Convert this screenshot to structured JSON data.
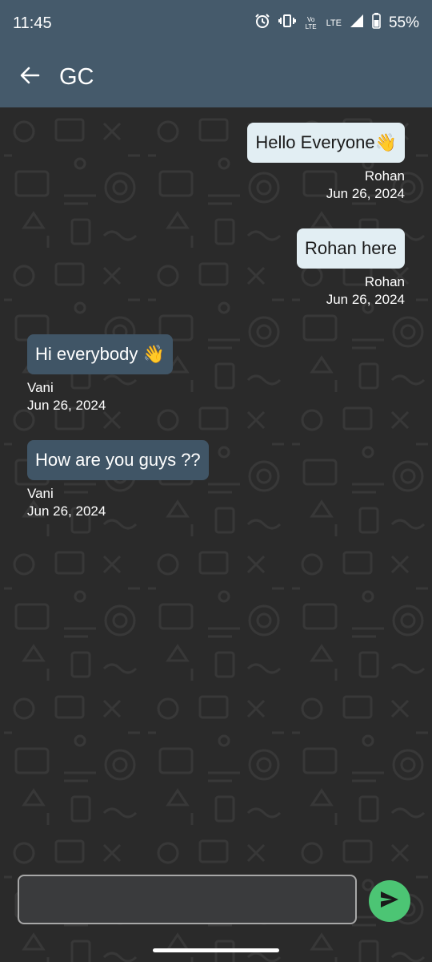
{
  "status_bar": {
    "time": "11:45",
    "volte_label": "Vo LTE",
    "network_label": "LTE",
    "battery_percent": "55%",
    "icons": [
      "alarm-icon",
      "vibrate-icon",
      "volte-icon",
      "signal-icon",
      "battery-icon"
    ]
  },
  "header": {
    "title": "GC",
    "back_icon": "arrow-back-icon"
  },
  "messages": [
    {
      "text": "Hello Everyone👋",
      "sender": "Rohan",
      "date": "Jun 26, 2024",
      "side": "right"
    },
    {
      "text": "Rohan here",
      "sender": "Rohan",
      "date": "Jun 26, 2024",
      "side": "right"
    },
    {
      "text": "Hi everybody 👋",
      "sender": "Vani",
      "date": "Jun 26, 2024",
      "side": "left"
    },
    {
      "text": "How are you guys ??",
      "sender": "Vani",
      "date": "Jun 26, 2024",
      "side": "left"
    }
  ],
  "composer": {
    "value": "",
    "placeholder": "",
    "send_icon": "send-icon"
  },
  "colors": {
    "app_bar": "#455a6b",
    "my_bubble": "#e2eef3",
    "their_bubble": "#405566",
    "send_button": "#4cc574",
    "chat_background": "#2a2a2a"
  }
}
